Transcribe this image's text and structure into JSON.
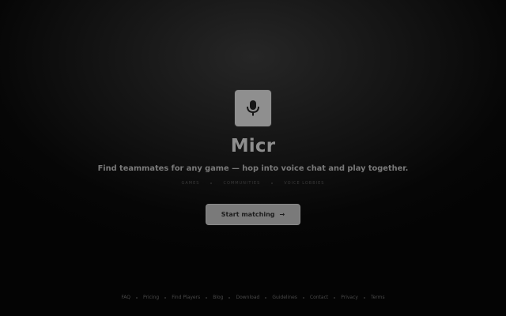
{
  "brand": {
    "name": "Micr",
    "icon": "microphone-icon"
  },
  "hero": {
    "tagline": "Find teammates for any game — hop into voice chat and play together.",
    "tags": [
      "GAMES",
      "COMMUNITIES",
      "VOICE LOBBIES"
    ],
    "cta_label": "Start matching",
    "cta_icon": "arrow-right-icon"
  },
  "footer": {
    "links": [
      "FAQ",
      "Pricing",
      "Find Players",
      "Blog",
      "Download",
      "Guidelines",
      "Contact",
      "Privacy",
      "Terms"
    ]
  },
  "colors": {
    "background": "#050505",
    "logo_bg": "#8f8f8f",
    "button_bg": "#7a7a7a",
    "text_muted": "#7a7a7a"
  }
}
